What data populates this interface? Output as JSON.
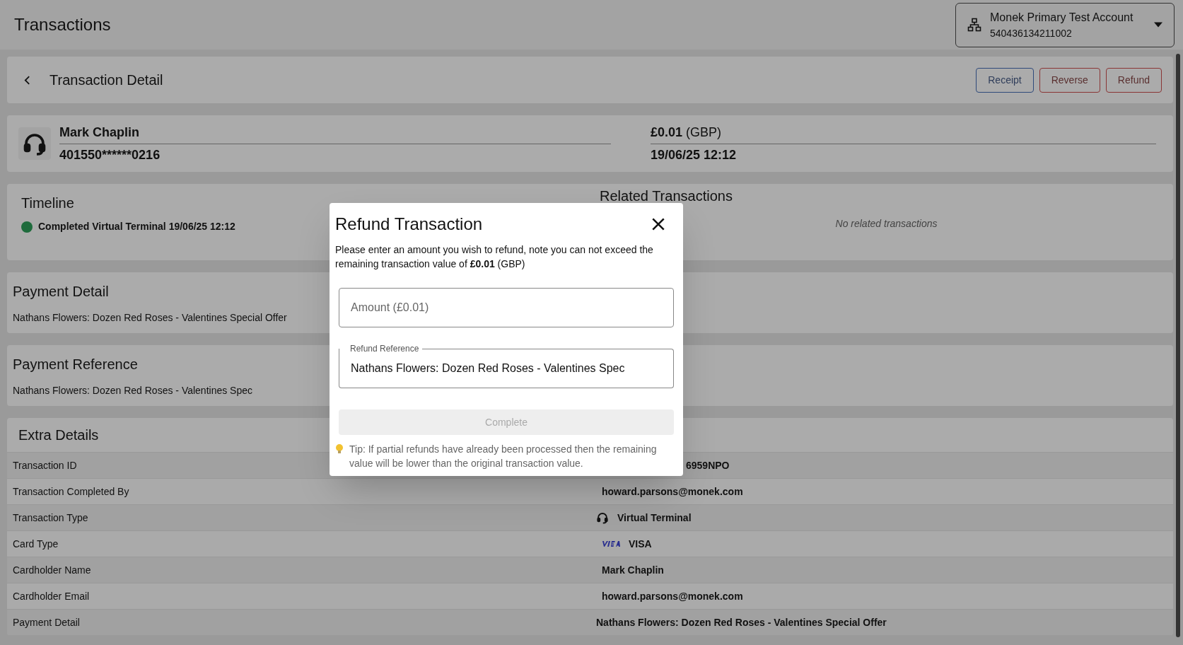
{
  "header": {
    "title": "Transactions",
    "account": {
      "name": "Monek Primary Test Account",
      "number": "540436134211002"
    }
  },
  "detail_bar": {
    "title": "Transaction Detail",
    "buttons": [
      {
        "label": "Receipt",
        "kind": "primary"
      },
      {
        "label": "Reverse",
        "kind": "danger"
      },
      {
        "label": "Refund",
        "kind": "danger"
      }
    ]
  },
  "summary": {
    "name": "Mark Chaplin",
    "card_number": "401550******0216",
    "amount": "£0.01",
    "currency": "(GBP)",
    "datetime": "19/06/25 12:12"
  },
  "timeline": {
    "title": "Timeline",
    "events": [
      {
        "text": "Completed Virtual Terminal 19/06/25 12:12",
        "color": "#1e6b3c"
      }
    ]
  },
  "related": {
    "title": "Related Transactions",
    "empty_text": "No related transactions"
  },
  "payment_detail": {
    "title": "Payment Detail",
    "text": "Nathans Flowers: Dozen Red Roses - Valentines Special Offer"
  },
  "payment_reference": {
    "title": "Payment Reference",
    "text": "Nathans Flowers: Dozen Red Roses - Valentines Spec"
  },
  "extra_details": {
    "title": "Extra Details",
    "rows": [
      {
        "label": "Transaction ID",
        "value": "6959NPO",
        "kind": "covered"
      },
      {
        "label": "Transaction Completed By",
        "value": "howard.parsons@monek.com",
        "kind": "plain"
      },
      {
        "label": "Transaction Type",
        "value": "Virtual Terminal",
        "kind": "headset"
      },
      {
        "label": "Card Type",
        "value": "VISA",
        "kind": "visa"
      },
      {
        "label": "Cardholder Name",
        "value": "Mark Chaplin",
        "kind": "plain"
      },
      {
        "label": "Cardholder Email",
        "value": "howard.parsons@monek.com",
        "kind": "plain"
      },
      {
        "label": "Payment Detail",
        "value": "Nathans Flowers: Dozen Red Roses - Valentines Special Offer",
        "kind": "wide"
      }
    ]
  },
  "modal": {
    "title": "Refund Transaction",
    "message": "Please enter an amount you wish to refund, note you can not exceed the remaining transaction value of **£0.01** (GBP)",
    "amount_field": {
      "placeholder": "Amount (£0.01)"
    },
    "reference_field": {
      "label": "Refund Reference",
      "value": "Nathans Flowers: Dozen Red Roses - Valentines Spec"
    },
    "complete_button": {
      "label": "Complete",
      "disabled": true
    },
    "tip": "Tip: If partial refunds have already been processed then the remaining value will be lower than the original transaction value."
  }
}
